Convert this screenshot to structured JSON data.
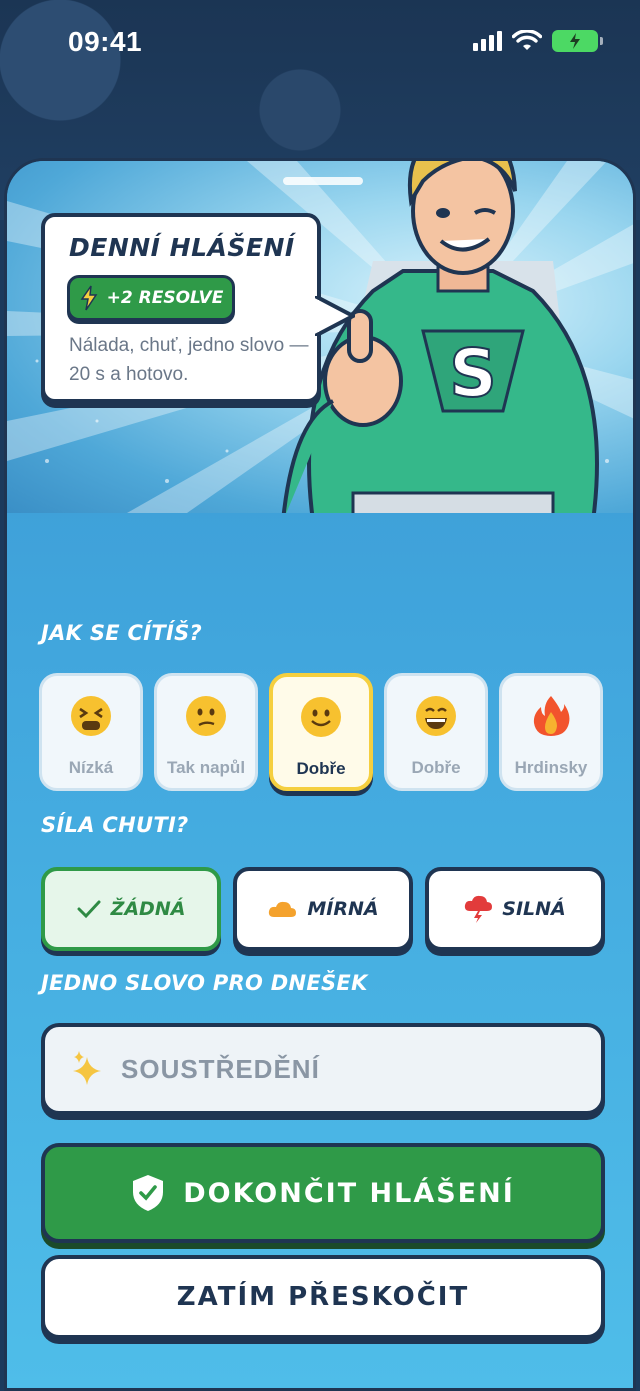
{
  "status_bar": {
    "time": "09:41"
  },
  "hero": {
    "title": "DENNÍ HLÁŠENÍ",
    "badge": "+2 RESOLVE",
    "description": "Nálada, chuť, jedno slovo — 20 s a hotovo."
  },
  "mood": {
    "label": "JAK SE CÍTÍŠ?",
    "options": [
      {
        "label": "Nízká",
        "icon": "tired-face-icon",
        "selected": false
      },
      {
        "label": "Tak napůl",
        "icon": "confused-face-icon",
        "selected": false
      },
      {
        "label": "Dobře",
        "icon": "smiling-face-icon",
        "selected": true
      },
      {
        "label": "Dobře",
        "icon": "grinning-face-icon",
        "selected": false
      },
      {
        "label": "Hrdinsky",
        "icon": "fire-icon",
        "selected": false
      }
    ]
  },
  "craving": {
    "label": "SÍLA CHUTI?",
    "options": [
      {
        "label": "ŽÁDNÁ",
        "icon": "check-icon",
        "selected": true
      },
      {
        "label": "MÍRNÁ",
        "icon": "cloud-icon",
        "selected": false
      },
      {
        "label": "SILNÁ",
        "icon": "storm-cloud-icon",
        "selected": false
      }
    ]
  },
  "word": {
    "label": "JEDNO SLOVO PRO DNEŠEK",
    "placeholder": "SOUSTŘEDĚNÍ",
    "icon": "sparkles-icon"
  },
  "actions": {
    "primary": "DOKONČIT HLÁŠENÍ",
    "secondary": "ZATÍM PŘESKOČIT"
  },
  "colors": {
    "navy": "#1f3552",
    "green": "#2f9a48",
    "yellow": "#f5cf3f",
    "sky": "#41a6dd"
  }
}
